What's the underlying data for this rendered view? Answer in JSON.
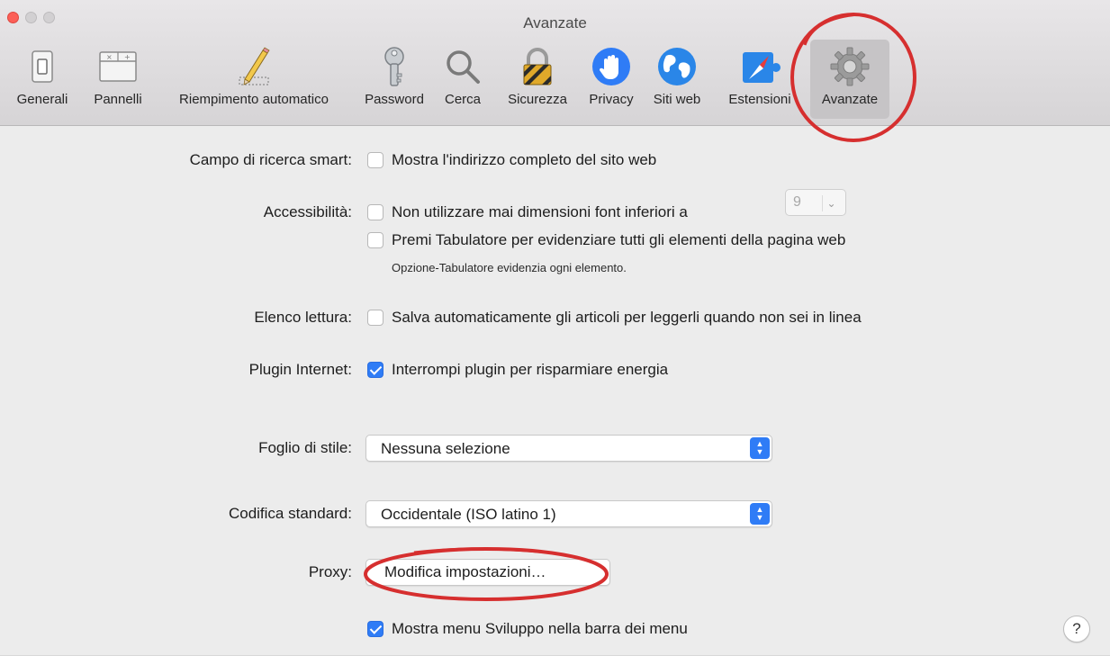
{
  "window": {
    "title": "Avanzate"
  },
  "toolbar": {
    "items": [
      {
        "label": "Generali",
        "icon": "general-switch-icon"
      },
      {
        "label": "Pannelli",
        "icon": "tabs-panel-icon"
      },
      {
        "label": "Riempimento automatico",
        "icon": "pencil-autofill-icon"
      },
      {
        "label": "Password",
        "icon": "key-icon"
      },
      {
        "label": "Cerca",
        "icon": "magnifier-icon"
      },
      {
        "label": "Sicurezza",
        "icon": "padlock-icon"
      },
      {
        "label": "Privacy",
        "icon": "hand-privacy-icon"
      },
      {
        "label": "Siti web",
        "icon": "globe-icon"
      },
      {
        "label": "Estensioni",
        "icon": "puzzle-compass-icon"
      },
      {
        "label": "Avanzate",
        "icon": "gear-icon",
        "selected": true
      }
    ]
  },
  "settings": {
    "smart_search": {
      "label": "Campo di ricerca smart:",
      "option": "Mostra l'indirizzo completo del sito web",
      "checked": false
    },
    "accessibility": {
      "label": "Accessibilità:",
      "option_font": "Non utilizzare mai dimensioni font inferiori a",
      "font_size_value": "9",
      "font_checked": false,
      "option_tab": "Premi Tabulatore per evidenziare tutti gli elementi della pagina web",
      "tab_checked": false,
      "tab_hint": "Opzione-Tabulatore evidenzia ogni elemento."
    },
    "reading_list": {
      "label": "Elenco lettura:",
      "option": "Salva automaticamente gli articoli per leggerli quando non sei in linea",
      "checked": false
    },
    "internet_plugins": {
      "label": "Plugin Internet:",
      "option": "Interrompi plugin per risparmiare energia",
      "checked": true
    },
    "style_sheet": {
      "label": "Foglio di stile:",
      "value": "Nessuna selezione"
    },
    "default_encoding": {
      "label": "Codifica standard:",
      "value": "Occidentale (ISO latino 1)"
    },
    "proxy": {
      "label": "Proxy:",
      "button": "Modifica impostazioni…"
    },
    "develop_menu": {
      "option": "Mostra menu Sviluppo nella barra dei menu",
      "checked": true
    }
  },
  "help": {
    "label": "?"
  },
  "colors": {
    "accent": "#2f7cf6",
    "annotation": "#d62f2f",
    "close": "#fc5f57"
  }
}
